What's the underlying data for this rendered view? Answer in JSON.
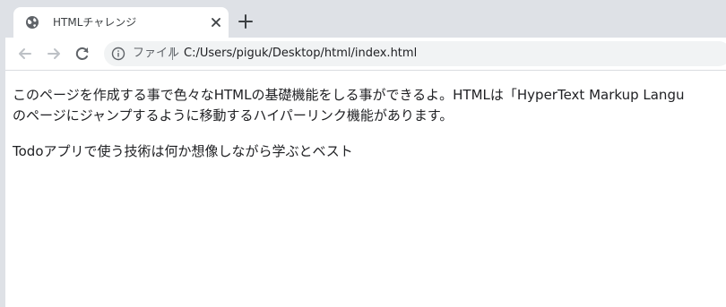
{
  "tab": {
    "title": "HTMLチャレンジ",
    "favicon": "globe-icon",
    "close_icon": "close-icon"
  },
  "new_tab_icon": "plus-icon",
  "toolbar": {
    "back_icon": "back-arrow-icon",
    "forward_icon": "forward-arrow-icon",
    "reload_icon": "reload-icon",
    "info_icon": "info-icon",
    "scheme_label": "ファイル",
    "url": "C:/Users/piguk/Desktop/html/index.html"
  },
  "content": {
    "paragraph1_line1": "このページを作成する事で色々なHTMLの基礎機能をしる事ができるよ。HTMLは「HyperText Markup Langu",
    "paragraph1_line2": "のページにジャンプするように移動するハイパーリンク機能があります。",
    "paragraph2": "Todoアプリで使う技術は何か想像しながら学ぶとベスト"
  },
  "colors": {
    "tabstrip_bg": "#dee1e6",
    "omnibox_bg": "#f1f3f4",
    "text": "#202124"
  }
}
